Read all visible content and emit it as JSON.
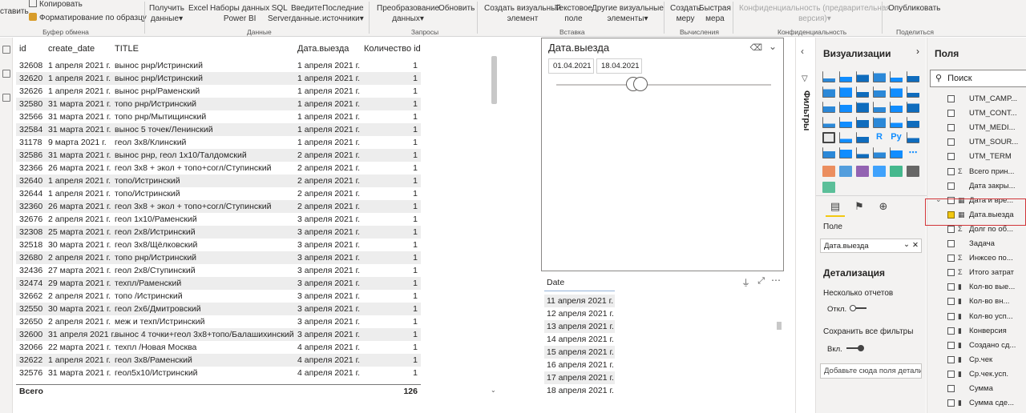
{
  "ribbon": {
    "paste_label": "ставить",
    "copy_label": "Копировать",
    "format_painter_label": "Форматирование по образцу",
    "get_data_label": "Получить",
    "get_data_label2": "данные",
    "excel_label": "Excel",
    "pbi_datasets_label": "Наборы данных",
    "pbi_datasets_label2": "Power BI",
    "sql_label": "SQL",
    "sql_label2": "Server",
    "enter_data_label": "Введите",
    "enter_data_label2": "данные.",
    "recent_label": "Последние",
    "recent_label2": "источники",
    "transform_label": "Преобразование",
    "transform_label2": "данных",
    "refresh_label": "Обновить",
    "new_visual_label": "Создать визуальный",
    "new_visual_label2": "элемент",
    "textbox_label": "Текстовое",
    "textbox_label2": "поле",
    "more_visuals_label": "Другие визуальные",
    "more_visuals_label2": "элементы",
    "new_measure_label": "Создать",
    "new_measure_label2": "меру",
    "quick_measure_label": "Быстрая",
    "quick_measure_label2": "мера",
    "sensitivity_label": "Конфиденциальность (предварительная",
    "sensitivity_label2": "версия)",
    "publish_label": "Опубликовать",
    "groups": {
      "clipboard": "Буфер обмена",
      "data": "Данные",
      "queries": "Запросы",
      "insert": "Вставка",
      "calculations": "Вычисления",
      "sensitivity": "Конфиденциальность",
      "share": "Поделиться"
    }
  },
  "table": {
    "headers": [
      "id",
      "create_date",
      "TITLE",
      "Дата.выезда",
      "Количество id"
    ],
    "rows": [
      [
        "32608",
        "1 апреля 2021 г.",
        "вынос рнр/Истринский",
        "1 апреля 2021 г.",
        "1"
      ],
      [
        "32620",
        "1 апреля 2021 г.",
        "вынос рнр/Истринский",
        "1 апреля 2021 г.",
        "1"
      ],
      [
        "32626",
        "1 апреля 2021 г.",
        "вынос рнр/Раменский",
        "1 апреля 2021 г.",
        "1"
      ],
      [
        "32580",
        "31 марта 2021 г.",
        "топо рнр/Истринский",
        "1 апреля 2021 г.",
        "1"
      ],
      [
        "32566",
        "31 марта 2021 г.",
        "топо рнр/Мытищинский",
        "1 апреля 2021 г.",
        "1"
      ],
      [
        "32584",
        "31 марта 2021 г.",
        "вынос 5 точек/Ленинский",
        "1 апреля 2021 г.",
        "1"
      ],
      [
        "31178",
        "9 марта 2021 г.",
        "геол 3х8/Клинский",
        "1 апреля 2021 г.",
        "1"
      ],
      [
        "32586",
        "31 марта 2021 г.",
        "вынос рнр, геол 1х10/Талдомский",
        "2 апреля 2021 г.",
        "1"
      ],
      [
        "32366",
        "26 марта 2021 г.",
        "геол 3х8 + экол + топо+согл/Ступинский",
        "2 апреля 2021 г.",
        "1"
      ],
      [
        "32640",
        "1 апреля 2021 г.",
        "топо/Истринский",
        "2 апреля 2021 г.",
        "1"
      ],
      [
        "32644",
        "1 апреля 2021 г.",
        "топо/Истринский",
        "2 апреля 2021 г.",
        "1"
      ],
      [
        "32360",
        "26 марта 2021 г.",
        "геол 3х8 + экол + топо+согл/Ступинский",
        "2 апреля 2021 г.",
        "1"
      ],
      [
        "32676",
        "2 апреля 2021 г.",
        "геол 1х10/Раменский",
        "3 апреля 2021 г.",
        "1"
      ],
      [
        "32308",
        "25 марта 2021 г.",
        "геол 2х8/Истринский",
        "3 апреля 2021 г.",
        "1"
      ],
      [
        "32518",
        "30 марта 2021 г.",
        "геол 3х8/Щёлковский",
        "3 апреля 2021 г.",
        "1"
      ],
      [
        "32680",
        "2 апреля 2021 г.",
        "топо рнр/Истринский",
        "3 апреля 2021 г.",
        "1"
      ],
      [
        "32436",
        "27 марта 2021 г.",
        "геол 2х8/Ступинский",
        "3 апреля 2021 г.",
        "1"
      ],
      [
        "32474",
        "29 марта 2021 г.",
        "техпл/Раменский",
        "3 апреля 2021 г.",
        "1"
      ],
      [
        "32662",
        "2 апреля 2021 г.",
        "топо /Истринский",
        "3 апреля 2021 г.",
        "1"
      ],
      [
        "32550",
        "30 марта 2021 г.",
        "геол 2х6/Дмитровский",
        "3 апреля 2021 г.",
        "1"
      ],
      [
        "32650",
        "2 апреля 2021 г.",
        "меж и техп/Истринский",
        "3 апреля 2021 г.",
        "1"
      ],
      [
        "32600",
        "31 апреля 2021 г.",
        "вынос 4 точки+геол 3х8+топо/Балашихинский",
        "3 апреля 2021 г.",
        "1"
      ],
      [
        "32066",
        "22 марта 2021 г.",
        "техпл /Новая Москва",
        "4 апреля 2021 г.",
        "1"
      ],
      [
        "32622",
        "1 апреля 2021 г.",
        "геол 3х8/Раменский",
        "4 апреля 2021 г.",
        "1"
      ],
      [
        "32576",
        "31 марта 2021 г.",
        "геол5х10/Истринский",
        "4 апреля 2021 г.",
        "1"
      ]
    ],
    "total_label": "Всего",
    "total_value": "126"
  },
  "slicer": {
    "title": "Дата.выезда",
    "start_date": "01.04.2021",
    "end_date": "18.04.2021",
    "range_start_fraction": 0.36,
    "range_end_fraction": 0.39
  },
  "date_list": {
    "header": "Date",
    "items": [
      "11 апреля 2021 г.",
      "12 апреля 2021 г.",
      "13 апреля 2021 г.",
      "14 апреля 2021 г.",
      "15 апреля 2021 г.",
      "16 апреля 2021 г.",
      "17 апреля 2021 г.",
      "18 апреля 2021 г."
    ]
  },
  "filters": {
    "label": "Фильтры"
  },
  "visualizations": {
    "title": "Визуализации",
    "field_label": "Поле",
    "field_value": "Дата.выезда",
    "drillthrough_title": "Детализация",
    "cross_report_label": "Несколько отчетов",
    "cross_report_state": "Откл.",
    "keep_filters_label": "Сохранить все фильтры",
    "keep_filters_state": "Вкл.",
    "drop_placeholder": "Добавьте сюда поля детализации"
  },
  "fields": {
    "title": "Поля",
    "search_placeholder": "Поиск",
    "items": [
      {
        "name": "UTM_CAMP...",
        "type": "",
        "checked": false
      },
      {
        "name": "UTM_CONT...",
        "type": "",
        "checked": false
      },
      {
        "name": "UTM_MEDI...",
        "type": "",
        "checked": false
      },
      {
        "name": "UTM_SOUR...",
        "type": "",
        "checked": false
      },
      {
        "name": "UTM_TERM",
        "type": "",
        "checked": false
      },
      {
        "name": "Всего прин...",
        "type": "Σ",
        "checked": false
      },
      {
        "name": "Дата закры...",
        "type": "",
        "checked": false
      },
      {
        "name": "Дата и вре...",
        "type": "▦",
        "checked": false
      },
      {
        "name": "Дата.выезда",
        "type": "▦",
        "checked": true
      },
      {
        "name": "Долг по об...",
        "type": "Σ",
        "checked": false
      },
      {
        "name": "Задача",
        "type": "",
        "checked": false
      },
      {
        "name": "Инжсео по...",
        "type": "Σ",
        "checked": false
      },
      {
        "name": "Итого затрат",
        "type": "Σ",
        "checked": false
      },
      {
        "name": "Кол-во вые...",
        "type": "▮",
        "checked": false
      },
      {
        "name": "Кол-во вн...",
        "type": "▮",
        "checked": false
      },
      {
        "name": "Кол-во усп...",
        "type": "▮",
        "checked": false
      },
      {
        "name": "Конверсия",
        "type": "▮",
        "checked": false
      },
      {
        "name": "Создано сд...",
        "type": "▮",
        "checked": false
      },
      {
        "name": "Ср.чек",
        "type": "▮",
        "checked": false
      },
      {
        "name": "Ср.чек.усп.",
        "type": "▮",
        "checked": false
      },
      {
        "name": "Сумма",
        "type": "",
        "checked": false
      },
      {
        "name": "Сумма сде...",
        "type": "▮",
        "checked": false
      }
    ]
  },
  "colors": {
    "accent_yellow": "#f2c811",
    "highlight_red": "#d13438",
    "pane_bg": "#f3f2f1"
  }
}
